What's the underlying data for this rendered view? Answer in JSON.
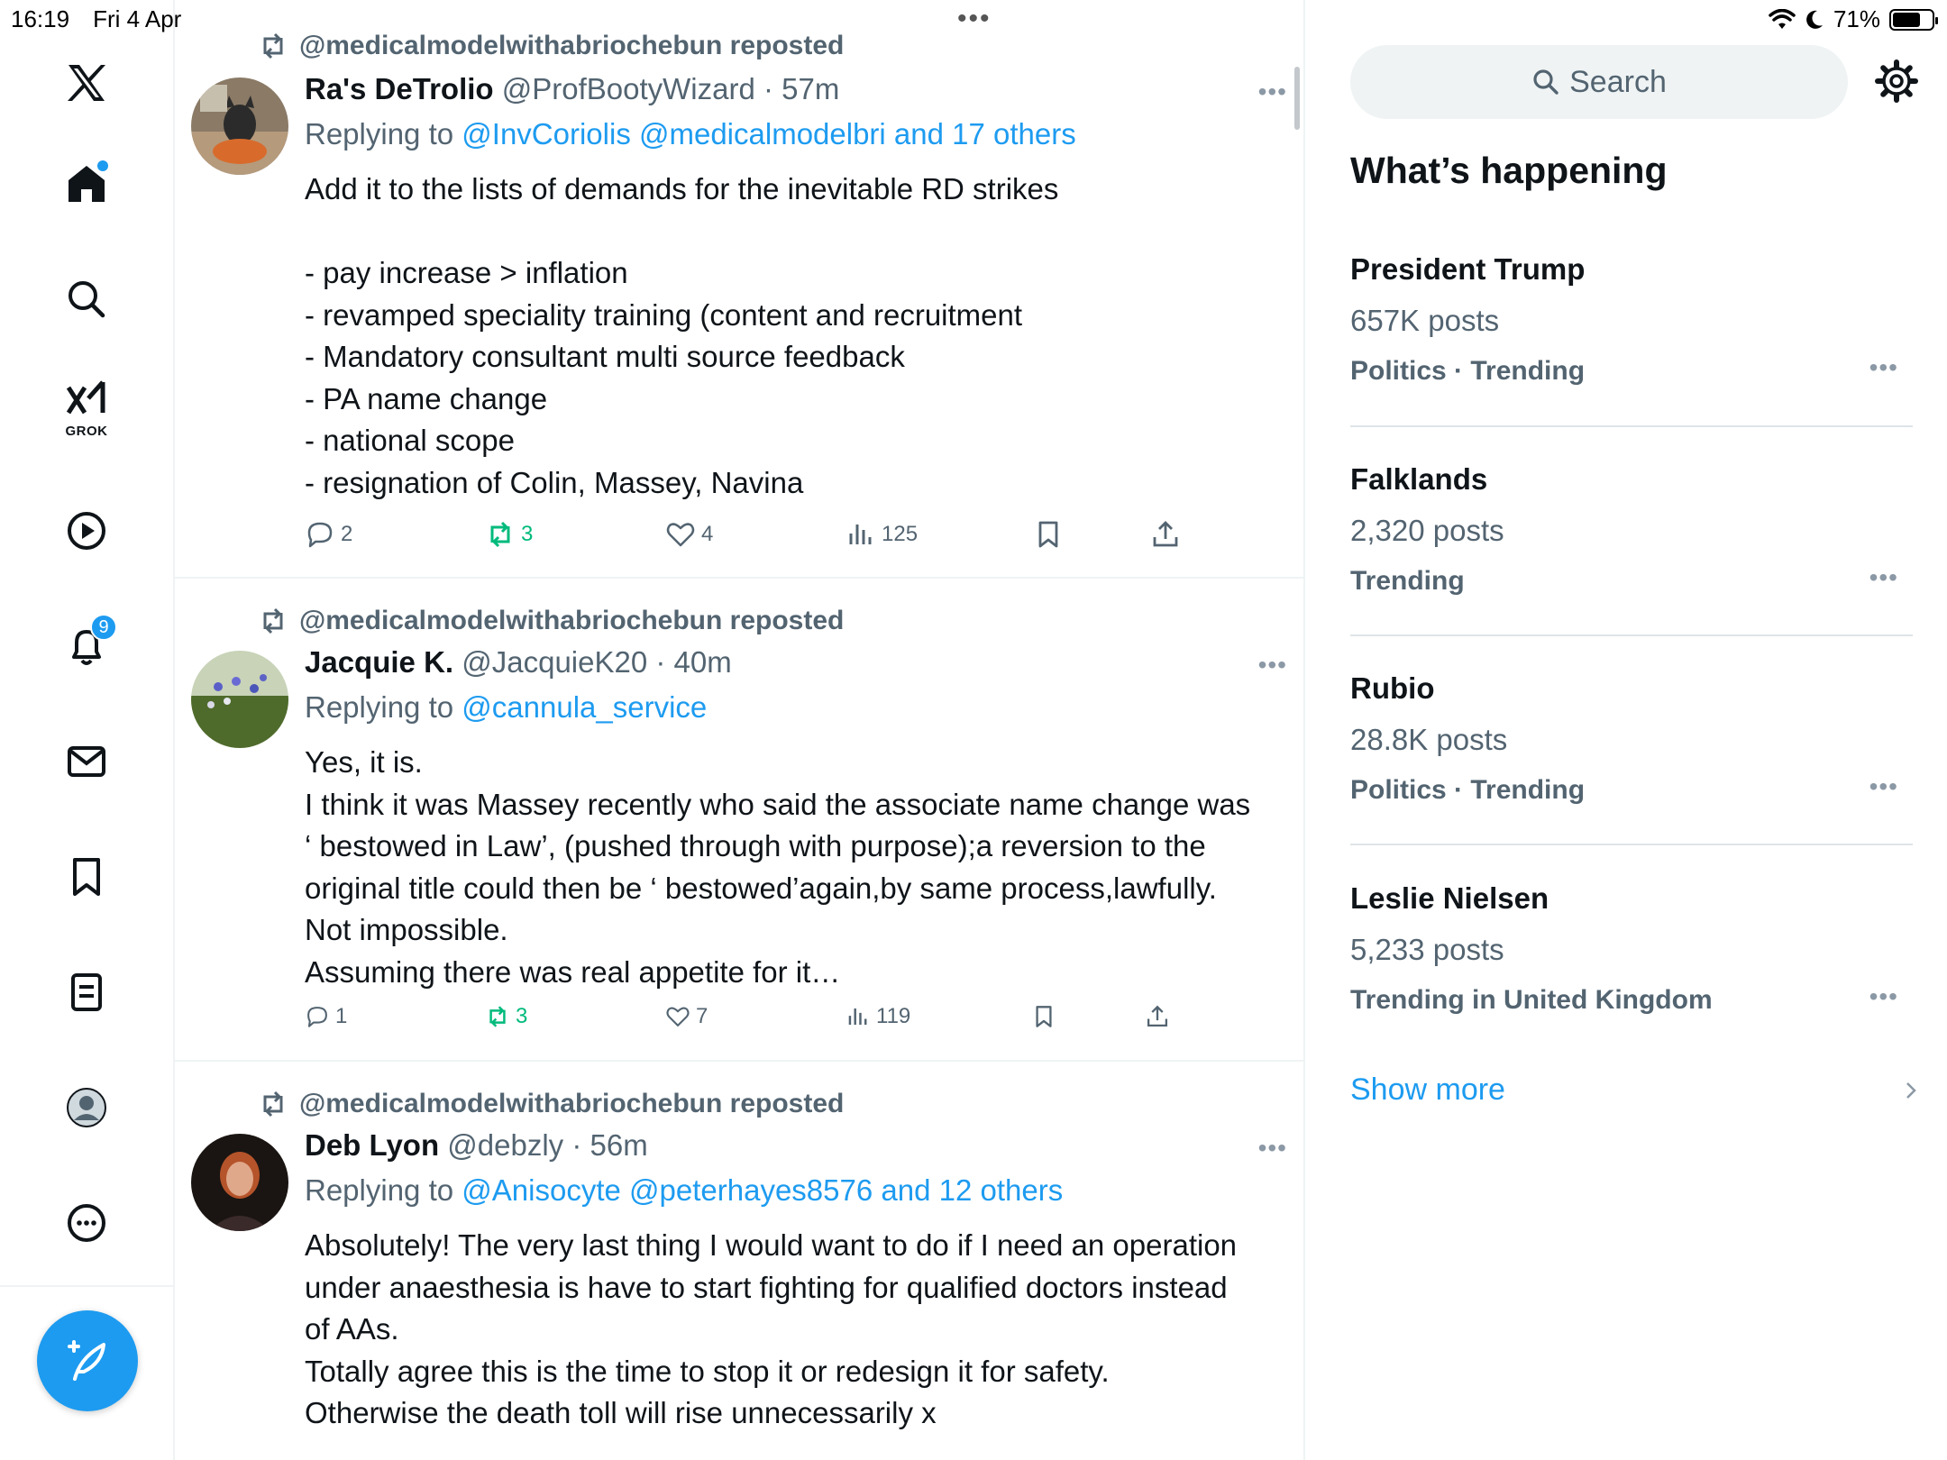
{
  "status": {
    "time": "16:19",
    "date": "Fri 4 Apr",
    "battery_text": "71%",
    "battery_level": 0.71
  },
  "nav": {
    "grok_label": "GROK",
    "notification_count": "9",
    "icons": [
      "x-logo-icon",
      "home-icon",
      "search-icon",
      "grok-icon",
      "video-icon",
      "bell-icon",
      "mail-icon",
      "bookmark-icon",
      "lists-icon",
      "profile-icon",
      "more-icon",
      "compose-icon"
    ],
    "accent": "#1d9bf0"
  },
  "tweets": [
    {
      "repost_label": "@medicalmodelwithabriochebun reposted",
      "name": "Ra's DeTrolio",
      "handle": "@ProfBootyWizard",
      "time": "· 57m",
      "replying_prefix": "Replying to",
      "replying_links": "@InvCoriolis @medicalmodelbri and 17 others",
      "lines": [
        "Add it to the lists of demands for the inevitable RD strikes",
        "",
        "- pay increase > inflation",
        "- revamped speciality training (content and recruitment",
        "- Mandatory consultant multi source feedback",
        "- PA name change",
        "- national scope",
        "- resignation of Colin, Massey, Navina"
      ],
      "replies": "2",
      "reposts": "3",
      "likes": "4",
      "views": "125"
    },
    {
      "repost_label": "@medicalmodelwithabriochebun reposted",
      "name": "Jacquie K.",
      "handle": "@JacquieK20",
      "time": "· 40m",
      "replying_prefix": "Replying to",
      "replying_links": "@cannula_service",
      "lines": [
        "Yes, it is.",
        "I think it was Massey recently who said the associate name change was",
        "‘ bestowed in Law’, (pushed through with purpose);a reversion to the",
        "original title could then be ‘ bestowed’again,by same process,lawfully.",
        "Not impossible.",
        "Assuming there was real appetite for it…"
      ],
      "replies": "1",
      "reposts": "3",
      "likes": "7",
      "views": "119"
    },
    {
      "repost_label": "@medicalmodelwithabriochebun reposted",
      "name": "Deb Lyon",
      "handle": "@debzly",
      "time": "· 56m",
      "replying_prefix": "Replying to",
      "replying_links": "@Anisocyte @peterhayes8576 and 12 others",
      "lines": [
        "Absolutely! The very last thing I would want to do if I need an operation",
        "under anaesthesia is have to start fighting for qualified doctors instead",
        "of AAs.",
        "Totally agree this is the time to stop it or redesign it for safety.",
        "Otherwise the death toll will rise unnecessarily x"
      ]
    }
  ],
  "sidebar": {
    "search_placeholder": "Search",
    "section_title": "What’s happening",
    "trends": [
      {
        "name": "President Trump",
        "posts": "657K posts",
        "category": "Politics · Trending"
      },
      {
        "name": "Falklands",
        "posts": "2,320 posts",
        "category": "Trending"
      },
      {
        "name": "Rubio",
        "posts": "28.8K posts",
        "category": "Politics · Trending"
      },
      {
        "name": "Leslie Nielsen",
        "posts": "5,233 posts",
        "category": "Trending in United Kingdom"
      }
    ],
    "show_more": "Show more"
  }
}
